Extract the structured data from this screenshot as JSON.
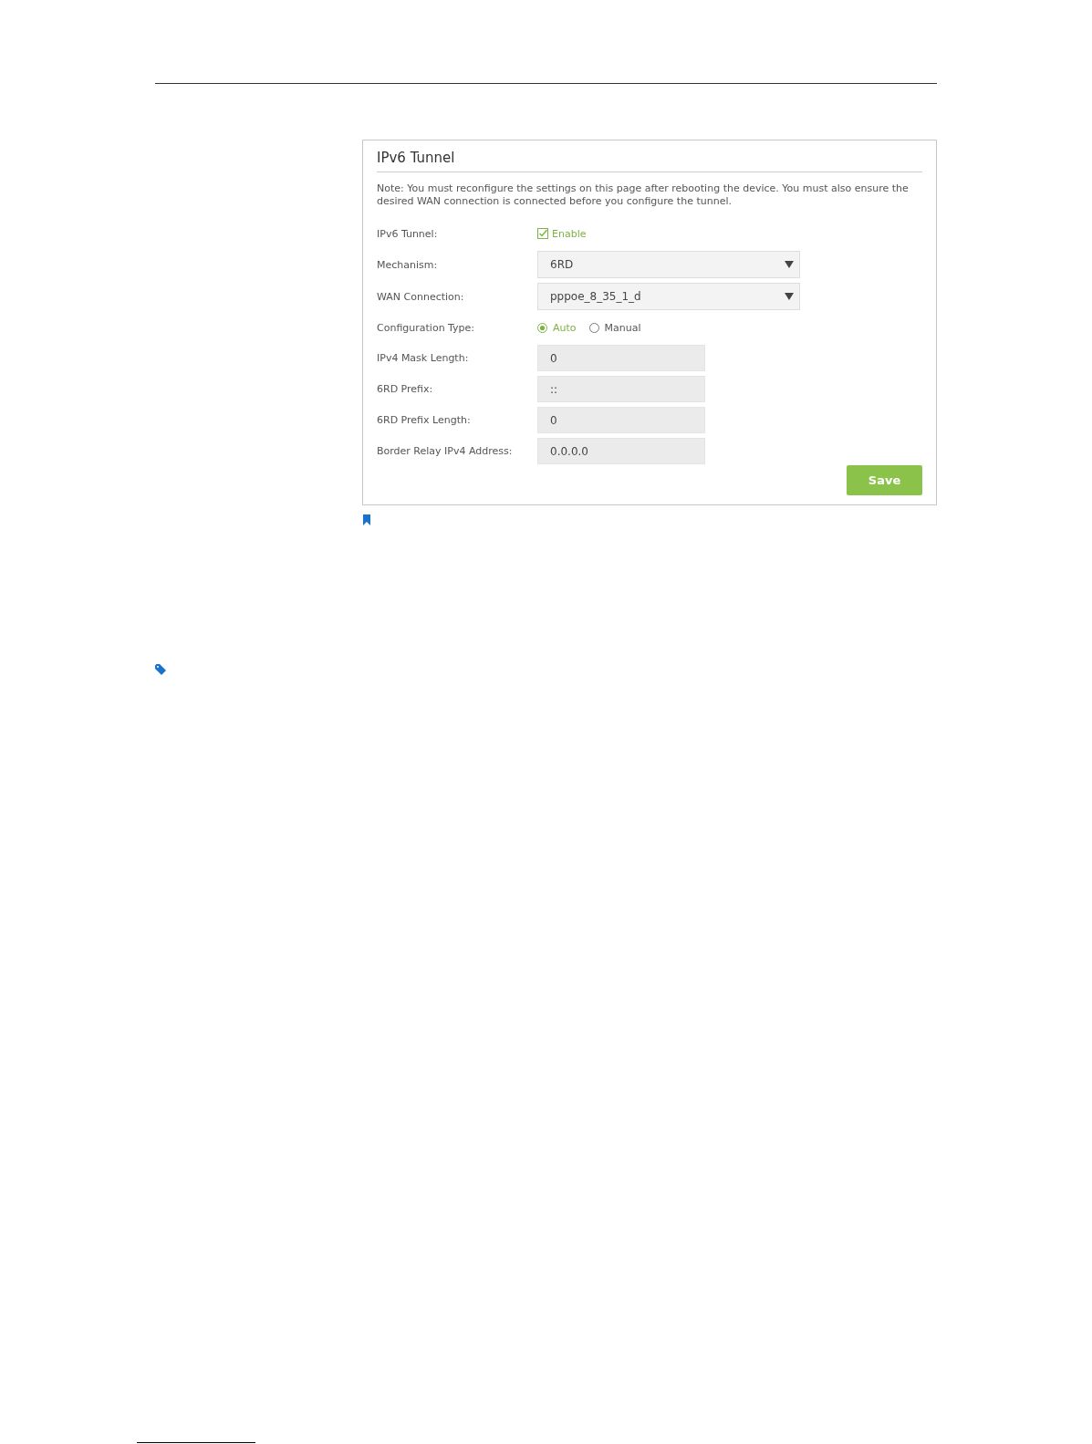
{
  "panel": {
    "title": "IPv6 Tunnel",
    "note": "Note: You must reconfigure the settings on this page after rebooting the device. You must also ensure the desired WAN connection is connected before you configure the tunnel.",
    "fields": [
      {
        "kind": "checkbox",
        "label": "IPv6 Tunnel:",
        "option": "Enable",
        "checked": true
      },
      {
        "kind": "select",
        "label": "Mechanism:",
        "value": "6RD"
      },
      {
        "kind": "select",
        "label": "WAN Connection:",
        "value": "pppoe_8_35_1_d"
      },
      {
        "kind": "radio",
        "label": "Configuration Type:",
        "options": [
          {
            "label": "Auto",
            "selected": true
          },
          {
            "label": "Manual",
            "selected": false
          }
        ]
      },
      {
        "kind": "text",
        "label": "IPv4 Mask Length:",
        "value": "0"
      },
      {
        "kind": "text",
        "label": "6RD Prefix:",
        "value": "::"
      },
      {
        "kind": "text",
        "label": "6RD Prefix Length:",
        "value": "0"
      },
      {
        "kind": "text",
        "label": "Border Relay IPv4 Address:",
        "value": "0.0.0.0"
      }
    ],
    "save_button": "Save"
  }
}
